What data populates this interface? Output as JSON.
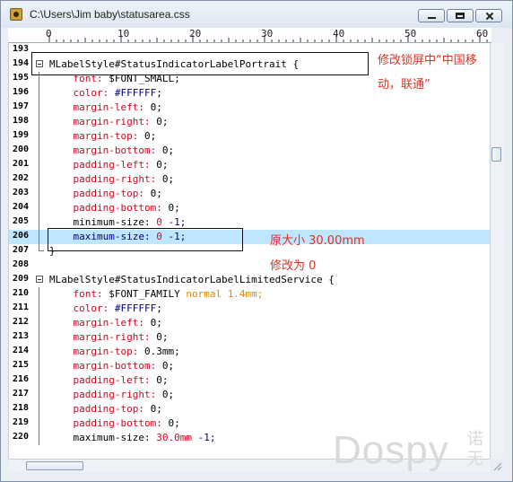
{
  "window": {
    "title": "C:\\Users\\Jim baby\\statusarea.css"
  },
  "ruler": {
    "labels": [
      "0",
      "10",
      "20",
      "30",
      "40",
      "50",
      "60"
    ]
  },
  "lines": [
    {
      "num": "193",
      "parts": []
    },
    {
      "num": "194",
      "fold": "open",
      "parts": [
        {
          "t": "MLabelStyle#StatusIndicatorLabelPortrait ",
          "c": "sel"
        },
        {
          "t": "{",
          "c": "brace"
        }
      ]
    },
    {
      "num": "195",
      "parts": [
        {
          "t": "    font: ",
          "c": "prop"
        },
        {
          "t": "$FONT_SMALL;",
          "c": "val"
        }
      ]
    },
    {
      "num": "196",
      "parts": [
        {
          "t": "    color: ",
          "c": "prop"
        },
        {
          "t": "#FFFFFF",
          "c": "col"
        },
        {
          "t": ";",
          "c": "val"
        }
      ]
    },
    {
      "num": "197",
      "parts": [
        {
          "t": "    margin-left: ",
          "c": "prop"
        },
        {
          "t": "0;",
          "c": "num"
        }
      ]
    },
    {
      "num": "198",
      "parts": [
        {
          "t": "    margin-right: ",
          "c": "prop"
        },
        {
          "t": "0;",
          "c": "num"
        }
      ]
    },
    {
      "num": "199",
      "parts": [
        {
          "t": "    margin-top: ",
          "c": "prop"
        },
        {
          "t": "0;",
          "c": "num"
        }
      ]
    },
    {
      "num": "200",
      "parts": [
        {
          "t": "    margin-bottom: ",
          "c": "prop"
        },
        {
          "t": "0;",
          "c": "num"
        }
      ]
    },
    {
      "num": "201",
      "parts": [
        {
          "t": "    padding-left: ",
          "c": "prop"
        },
        {
          "t": "0;",
          "c": "num"
        }
      ]
    },
    {
      "num": "202",
      "parts": [
        {
          "t": "    padding-right: ",
          "c": "prop"
        },
        {
          "t": "0;",
          "c": "num"
        }
      ]
    },
    {
      "num": "203",
      "parts": [
        {
          "t": "    padding-top: ",
          "c": "prop"
        },
        {
          "t": "0;",
          "c": "num"
        }
      ]
    },
    {
      "num": "204",
      "parts": [
        {
          "t": "    padding-bottom: ",
          "c": "prop"
        },
        {
          "t": "0;",
          "c": "num"
        }
      ]
    },
    {
      "num": "205",
      "parts": [
        {
          "t": "    minimum-size: ",
          "c": "val"
        },
        {
          "t": "0 ",
          "c": "prop"
        },
        {
          "t": "-1;",
          "c": "col"
        }
      ]
    },
    {
      "num": "206",
      "highlight": true,
      "parts": [
        {
          "t": "    maximum-size: ",
          "c": "col"
        },
        {
          "t": "0 ",
          "c": "prop"
        },
        {
          "t": "-1;",
          "c": "col"
        }
      ]
    },
    {
      "num": "207",
      "fold": "end",
      "parts": [
        {
          "t": "}",
          "c": "brace"
        }
      ]
    },
    {
      "num": "208",
      "parts": []
    },
    {
      "num": "209",
      "fold": "open",
      "parts": [
        {
          "t": "MLabelStyle#StatusIndicatorLabelLimitedService ",
          "c": "sel"
        },
        {
          "t": "{",
          "c": "brace"
        }
      ]
    },
    {
      "num": "210",
      "parts": [
        {
          "t": "    font: ",
          "c": "prop"
        },
        {
          "t": "$FONT_FAMILY ",
          "c": "val"
        },
        {
          "t": "normal ",
          "c": "norm"
        },
        {
          "t": "1.4mm;",
          "c": "dim"
        }
      ]
    },
    {
      "num": "211",
      "parts": [
        {
          "t": "    color: ",
          "c": "prop"
        },
        {
          "t": "#FFFFFF",
          "c": "col"
        },
        {
          "t": ";",
          "c": "val"
        }
      ]
    },
    {
      "num": "212",
      "parts": [
        {
          "t": "    margin-left: ",
          "c": "prop"
        },
        {
          "t": "0;",
          "c": "num"
        }
      ]
    },
    {
      "num": "213",
      "parts": [
        {
          "t": "    margin-right: ",
          "c": "prop"
        },
        {
          "t": "0;",
          "c": "num"
        }
      ]
    },
    {
      "num": "214",
      "parts": [
        {
          "t": "    margin-top: ",
          "c": "prop"
        },
        {
          "t": "0.3mm;",
          "c": "num"
        }
      ]
    },
    {
      "num": "215",
      "parts": [
        {
          "t": "    margin-bottom: ",
          "c": "prop"
        },
        {
          "t": "0;",
          "c": "num"
        }
      ]
    },
    {
      "num": "216",
      "parts": [
        {
          "t": "    padding-left: ",
          "c": "prop"
        },
        {
          "t": "0;",
          "c": "num"
        }
      ]
    },
    {
      "num": "217",
      "parts": [
        {
          "t": "    padding-right: ",
          "c": "prop"
        },
        {
          "t": "0;",
          "c": "num"
        }
      ]
    },
    {
      "num": "218",
      "parts": [
        {
          "t": "    padding-top: ",
          "c": "prop"
        },
        {
          "t": "0;",
          "c": "num"
        }
      ]
    },
    {
      "num": "219",
      "parts": [
        {
          "t": "    padding-bottom: ",
          "c": "prop"
        },
        {
          "t": "0;",
          "c": "num"
        }
      ]
    },
    {
      "num": "220",
      "parts": [
        {
          "t": "    maximum-size: ",
          "c": "val"
        },
        {
          "t": "30.0mm ",
          "c": "prop"
        },
        {
          "t": "-1;",
          "c": "col"
        }
      ]
    }
  ],
  "annotations": {
    "note1_line1": "修改锁屏中“中国移",
    "note1_line2": "动，联通”",
    "note2_line1": "原大小 30.00mm",
    "note2_line2": "修改为 0"
  },
  "watermark": {
    "text": "Dospy",
    "side_line1": "诺",
    "side_line2": "无"
  },
  "colors": {
    "property": "#e0001f",
    "value_blue": "#000080",
    "keyword_orange": "#e08a00",
    "highlight_line": "#bfe6ff",
    "annotation_red": "#e0321f"
  }
}
